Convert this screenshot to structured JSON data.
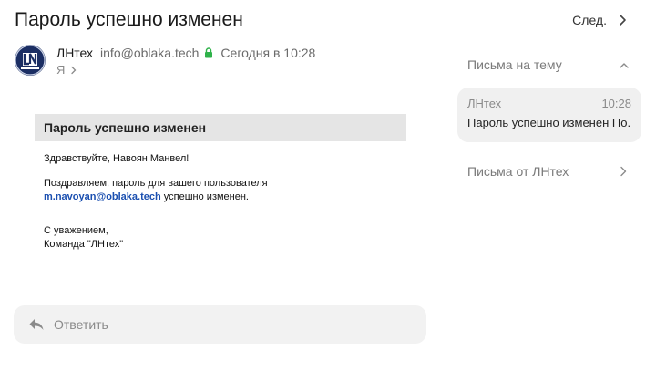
{
  "header": {
    "subject": "Пароль успешно изменен",
    "next_label": "След."
  },
  "sender": {
    "avatar_text": "LN",
    "name": "ЛНтех",
    "email": "info@oblaka.tech",
    "date": "Сегодня в 10:28",
    "to": "Я"
  },
  "letter": {
    "title": "Пароль успешно изменен",
    "greeting": "Здравствуйте, Навоян Манвел!",
    "congrats_line1": "Поздравляем, пароль для вашего пользователя",
    "user_email": "m.navoyan@oblaka.tech",
    "congrats_line2": " успешно изменен.",
    "sign_line1": "С уважением,",
    "sign_line2": "Команда \"ЛНтех\""
  },
  "reply": {
    "label": "Ответить"
  },
  "sidebar": {
    "thread_title": "Письма на тему",
    "thread_item": {
      "from": "ЛНтех",
      "time": "10:28",
      "subject": "Пароль успешно изменен По..."
    },
    "from_sender_label": "Письма от ЛНтех"
  },
  "colors": {
    "accent_link": "#1a4fb0",
    "lock_green": "#2fb24a",
    "avatar_bg": "#1b2e63"
  },
  "icons": {
    "next": "chevron-right-icon",
    "lock": "lock-icon",
    "to_expand": "chevron-right-icon",
    "reply": "reply-arrow-icon",
    "collapse": "chevron-up-icon",
    "from_sender": "chevron-right-icon"
  }
}
